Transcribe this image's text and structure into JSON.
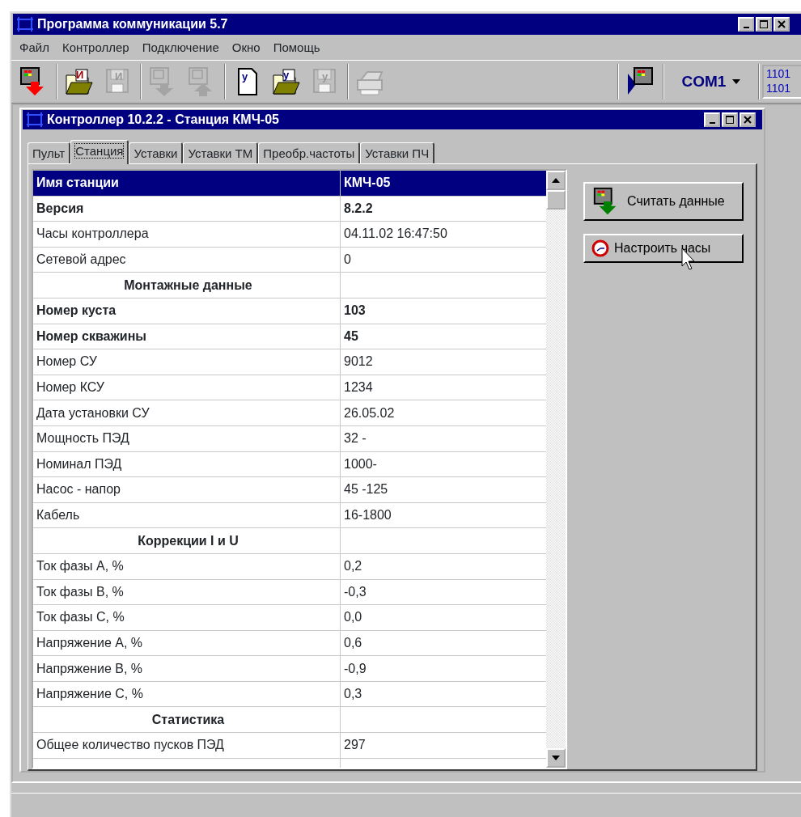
{
  "window": {
    "title": "Программа коммуникации 5.7"
  },
  "menu": [
    "Файл",
    "Контроллер",
    "Подключение",
    "Окно",
    "Помощь"
  ],
  "toolbar": [
    {
      "kind": "read",
      "disabled": false
    },
    {
      "kind": "open",
      "glyph": "И",
      "disabled": false
    },
    {
      "kind": "save",
      "glyph": "И",
      "disabled": true
    },
    {
      "kind": "download",
      "disabled": true
    },
    {
      "kind": "upload",
      "disabled": true
    },
    {
      "kind": "doc",
      "glyph": "у",
      "disabled": false
    },
    {
      "kind": "open",
      "glyph": "у",
      "disabled": false
    },
    {
      "kind": "save",
      "glyph": "у",
      "disabled": true
    },
    {
      "kind": "print",
      "disabled": true
    }
  ],
  "port": {
    "value": "COM1",
    "indicator": [
      "1101",
      "1101"
    ]
  },
  "child": {
    "title": "Контроллер 10.2.2 - Станция КМЧ-05",
    "tabs": [
      {
        "label": "Пульт",
        "selected": false
      },
      {
        "label": "Станция",
        "selected": true
      },
      {
        "label": "Уставки",
        "selected": false
      },
      {
        "label": "Уставки ТМ",
        "selected": false
      },
      {
        "label": "Преобр.частоты",
        "selected": false
      },
      {
        "label": "Уставки ПЧ",
        "selected": false
      }
    ],
    "rows": [
      {
        "kind": "normal",
        "bold": true,
        "selected": true,
        "name": "Имя станции",
        "value": "КМЧ-05"
      },
      {
        "kind": "normal",
        "bold": true,
        "selected": false,
        "name": "Версия",
        "value": "8.2.2"
      },
      {
        "kind": "normal",
        "bold": false,
        "selected": false,
        "name": "Часы контроллера",
        "value": "04.11.02 16:47:50"
      },
      {
        "kind": "normal",
        "bold": false,
        "selected": false,
        "name": "Сетевой адрес",
        "value": "0"
      },
      {
        "kind": "section",
        "bold": true,
        "selected": false,
        "name": "Монтажные данные"
      },
      {
        "kind": "normal",
        "bold": true,
        "selected": false,
        "name": "Номер куста",
        "value": "103"
      },
      {
        "kind": "normal",
        "bold": true,
        "selected": false,
        "name": "Номер скважины",
        "value": "45"
      },
      {
        "kind": "normal",
        "bold": false,
        "selected": false,
        "name": "Номер СУ",
        "value": "9012"
      },
      {
        "kind": "normal",
        "bold": false,
        "selected": false,
        "name": "Номер КСУ",
        "value": "1234"
      },
      {
        "kind": "normal",
        "bold": false,
        "selected": false,
        "name": "Дата установки СУ",
        "value": "26.05.02"
      },
      {
        "kind": "normal",
        "bold": false,
        "selected": false,
        "name": "Мощность ПЭД",
        "value": "32 -"
      },
      {
        "kind": "normal",
        "bold": false,
        "selected": false,
        "name": "Номинал ПЭД",
        "value": "1000-"
      },
      {
        "kind": "normal",
        "bold": false,
        "selected": false,
        "name": "Насос - напор",
        "value": "45 -125"
      },
      {
        "kind": "normal",
        "bold": false,
        "selected": false,
        "name": "Кабель",
        "value": "16-1800"
      },
      {
        "kind": "section",
        "bold": true,
        "selected": false,
        "name": "Коррекции I и U"
      },
      {
        "kind": "normal",
        "bold": false,
        "selected": false,
        "name": "Ток фазы А, %",
        "value": "0,2"
      },
      {
        "kind": "normal",
        "bold": false,
        "selected": false,
        "name": "Ток фазы В, %",
        "value": "-0,3"
      },
      {
        "kind": "normal",
        "bold": false,
        "selected": false,
        "name": "Ток фазы С, %",
        "value": "0,0"
      },
      {
        "kind": "normal",
        "bold": false,
        "selected": false,
        "name": "Напряжение А, %",
        "value": "0,6"
      },
      {
        "kind": "normal",
        "bold": false,
        "selected": false,
        "name": "Напряжение В, %",
        "value": "-0,9"
      },
      {
        "kind": "normal",
        "bold": false,
        "selected": false,
        "name": "Напряжение С, %",
        "value": "0,3"
      },
      {
        "kind": "section",
        "bold": true,
        "selected": false,
        "name": "Статистика"
      },
      {
        "kind": "normal",
        "bold": false,
        "selected": false,
        "name": "Общее количество пусков ПЭД",
        "value": "297"
      }
    ],
    "buttons": [
      {
        "kind": "read",
        "label": "Считать данные"
      },
      {
        "kind": "clock",
        "label": "Настроить часы"
      }
    ]
  }
}
